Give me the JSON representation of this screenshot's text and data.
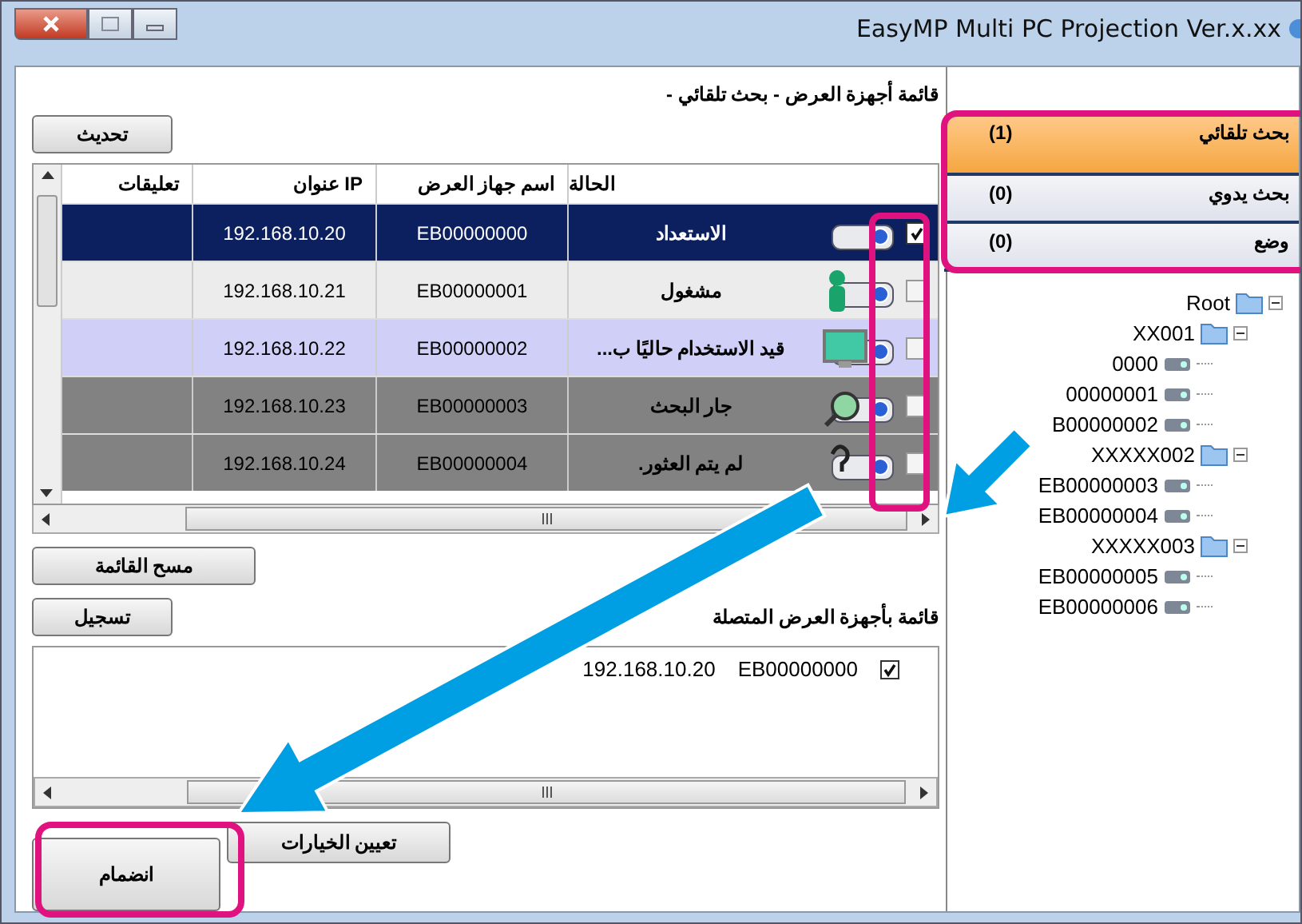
{
  "window": {
    "title": "EasyMP Multi PC Projection Ver.x.xx"
  },
  "list_heading": "قائمة أجهزة العرض - بحث تلقائي -",
  "refresh_button": "تحديث",
  "table": {
    "columns": [
      "الحالة",
      "اسم جهاز العرض",
      "عنوان IP",
      "تعليقات"
    ],
    "rows": [
      {
        "kind": "standby",
        "selected": true,
        "checked": true,
        "status": "الاستعداد",
        "name": "EB00000000",
        "ip": "192.168.10.20"
      },
      {
        "kind": "busy",
        "selected": false,
        "checked": false,
        "status": "مشغول",
        "name": "EB00000001",
        "ip": "192.168.10.21"
      },
      {
        "kind": "in_use",
        "selected": false,
        "checked": false,
        "status": "قيد الاستخدام حاليًا ب...",
        "name": "EB00000002",
        "ip": "192.168.10.22"
      },
      {
        "kind": "searching",
        "selected": false,
        "checked": false,
        "status": "جار البحث",
        "name": "EB00000003",
        "ip": "192.168.10.23"
      },
      {
        "kind": "not_found",
        "selected": false,
        "checked": false,
        "status": "لم يتم العثور.",
        "name": "EB00000004",
        "ip": "192.168.10.24"
      }
    ]
  },
  "clear_list_button": "مسح القائمة",
  "register_button": "تسجيل",
  "connected_heading": "قائمة بأجهزة العرض المتصلة",
  "connected": [
    {
      "checked": true,
      "name": "EB00000000",
      "ip": "192.168.10.20"
    }
  ],
  "join_button": "انضمام",
  "options_button": "تعيين الخيارات",
  "search_modes": [
    {
      "label": "بحث تلقائي",
      "count": "(1)",
      "selected": true
    },
    {
      "label": "بحث يدوي",
      "count": "(0)",
      "selected": false
    },
    {
      "label": "وضع",
      "count": "(0)",
      "selected": false
    }
  ],
  "tree": {
    "label": "Root",
    "kind": "folder",
    "children": [
      {
        "label": "XX001",
        "kind": "folder",
        "children": [
          {
            "label": "0000",
            "kind": "projector"
          },
          {
            "label": "00000001",
            "kind": "projector"
          },
          {
            "label": "B00000002",
            "kind": "projector"
          }
        ]
      },
      {
        "label": "XXXXX002",
        "kind": "folder",
        "children": [
          {
            "label": "EB00000003",
            "kind": "projector"
          },
          {
            "label": "EB00000004",
            "kind": "projector"
          }
        ]
      },
      {
        "label": "XXXXX003",
        "kind": "folder",
        "children": [
          {
            "label": "EB00000005",
            "kind": "projector"
          },
          {
            "label": "EB00000006",
            "kind": "projector"
          }
        ]
      }
    ]
  }
}
